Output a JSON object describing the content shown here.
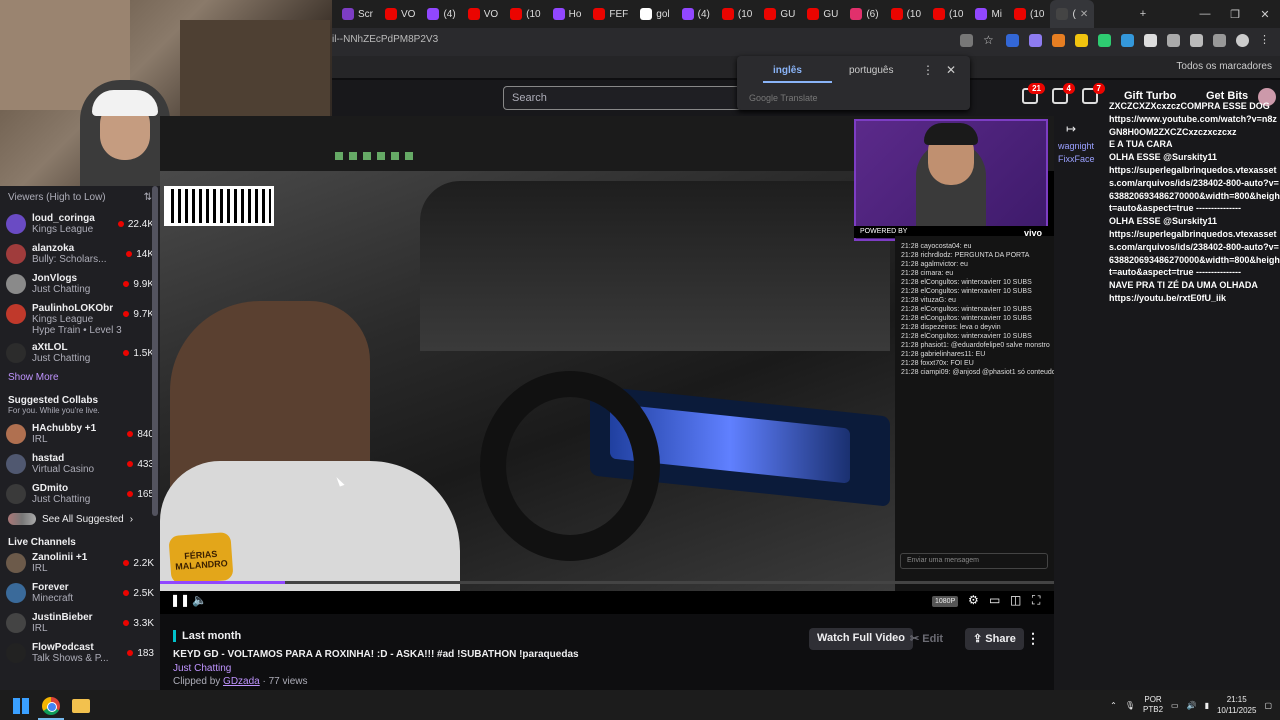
{
  "browser": {
    "tabs": [
      {
        "label": "Scr",
        "color": "#7d3dc4"
      },
      {
        "label": "VO",
        "color": "#eb0400"
      },
      {
        "label": "(4)",
        "color": "#9147ff"
      },
      {
        "label": "VO",
        "color": "#eb0400"
      },
      {
        "label": "(10",
        "color": "#eb0400"
      },
      {
        "label": "Ho",
        "color": "#9147ff"
      },
      {
        "label": "FEF",
        "color": "#eb0400"
      },
      {
        "label": "gol",
        "color": "#ffffff"
      },
      {
        "label": "(4)",
        "color": "#9147ff"
      },
      {
        "label": "(10",
        "color": "#eb0400"
      },
      {
        "label": "GU",
        "color": "#eb0400"
      },
      {
        "label": "GU",
        "color": "#eb0400"
      },
      {
        "label": "(6)",
        "color": "#e1306c"
      },
      {
        "label": "(10",
        "color": "#eb0400"
      },
      {
        "label": "(10",
        "color": "#eb0400"
      },
      {
        "label": "Mi",
        "color": "#9147ff"
      },
      {
        "label": "(10",
        "color": "#eb0400"
      },
      {
        "label": "(",
        "color": "#444444"
      }
    ],
    "url_fragment": "il--NNhZEcPdPM8P2V3",
    "bookmarks_label": "Todos os marcadores"
  },
  "translate": {
    "lang_from": "inglês",
    "lang_to": "português",
    "provider": "Google Translate"
  },
  "topnav": {
    "search_placeholder": "Search",
    "badge_inbox": "21",
    "badge_mail": "4",
    "badge_notif": "7",
    "gift_turbo": "Gift Turbo",
    "get_bits": "Get Bits"
  },
  "sidebar": {
    "sort_label": "Viewers (High to Low)",
    "followed": [
      {
        "name": "loud_coringa",
        "game": "Kings League",
        "viewers": "22.4K",
        "color": "#6a4bc4"
      },
      {
        "name": "alanzoka",
        "game": "Bully: Scholars...",
        "viewers": "14K",
        "color": "#a03c3c"
      },
      {
        "name": "JonVlogs",
        "game": "Just Chatting",
        "viewers": "9.9K",
        "color": "#8a8a8a"
      },
      {
        "name": "PaulinhoLOKObr",
        "game": "Kings League",
        "viewers": "9.7K",
        "color": "#c0392b"
      },
      {
        "name": "aXtLOL",
        "game": "Just Chatting",
        "viewers": "1.5K",
        "color": "#2c2c2c"
      }
    ],
    "hype_train": "Hype Train • Level 3",
    "show_more": "Show More",
    "suggested_title": "Suggested Collabs",
    "suggested_sub": "For you. While you're live.",
    "suggested": [
      {
        "name": "HAchubby +1",
        "game": "IRL",
        "viewers": "840",
        "color": "#b07050"
      },
      {
        "name": "hastad",
        "game": "Virtual Casino",
        "viewers": "433",
        "color": "#505870"
      },
      {
        "name": "GDmito",
        "game": "Just Chatting",
        "viewers": "165",
        "color": "#3a3a3a"
      }
    ],
    "see_all": "See All Suggested",
    "live_title": "Live Channels",
    "live": [
      {
        "name": "Zanolinii +1",
        "game": "IRL",
        "viewers": "2.2K",
        "color": "#6c5a4a"
      },
      {
        "name": "Forever",
        "game": "Minecraft",
        "viewers": "2.5K",
        "color": "#3a6a9a"
      },
      {
        "name": "JustinBieber",
        "game": "IRL",
        "viewers": "3.3K",
        "color": "#444444"
      },
      {
        "name": "FlowPodcast",
        "game": "Talk Shows & P...",
        "viewers": "183",
        "color": "#222222"
      }
    ]
  },
  "video": {
    "logo_text": "FÉRIAS MALANDRO",
    "chat_lines": [
      "21:28 cayocosta04: eu",
      "21:28 richrdlodz: PERGUNTA DA PORTA",
      "21:28 agalmvictor: eu",
      "21:28 cimara: eu",
      "21:28 elCongultos: winterxavierr 10 SUBS",
      "21:28 elCongultos: winterxavierr 10 SUBS",
      "21:28 vituzaG: eu",
      "21:28 elCongultos: winterxavierr 10 SUBS",
      "21:28 elCongultos: winterxavierr 10 SUBS",
      "21:28 dispezeiros: leva o deyvin",
      "21:28 elCongultos: winterxavierr 10 SUBS",
      "21:28 phasiot1: @eduardofelipe0 salve monstro",
      "21:28 gabrielinhares11: EU",
      "21:28 foxxt70x: FOI EU",
      "21:28 ciampi09: @anjosd @phasiot1 só conteudo"
    ],
    "chat_placeholder": "Enviar uma mensagem",
    "vivo_text": "POWERED BY",
    "vivo_brand": "vivo",
    "quality": "1080P",
    "progress": 0.14
  },
  "clip": {
    "period": "Last month",
    "title": "KEYD GD - VOLTAMOS PARA A ROXINHA! :D - ASKA!!! #ad !SUBATHON !paraquedas",
    "game": "Just Chatting",
    "clipped_by_prefix": "Clipped by",
    "clipper": "GDzada",
    "views": "· 77 views",
    "watch_full": "Watch Full Video",
    "edit": "Edit",
    "share": "Share"
  },
  "rchat": {
    "lines": [
      "ZXCZCXZXcxzczCOMPRA ESSE DOG",
      "https://www.youtube.com/watch?v=n8zGN8H0OM2ZXCZCxzczxczcxz",
      "E A TUA CARA",
      "OLHA ESSE @Surskity11",
      "https://superlegalbrinquedos.vtexassets.com/arquivos/ids/238402-800-auto?v=638820693486270000&width=800&height=auto&aspect=true ---------------",
      "OLHA ESSE @Surskity11",
      "https://superlegalbrinquedos.vtexassets.com/arquivos/ids/238402-800-auto?v=638820693486270000&width=800&height=auto&aspect=true ---------------",
      "NAVE PRA TI ZÉ DA UMA OLHADA",
      "https://youtu.be/rxtE0fU_iik"
    ],
    "names": [
      {
        "name": "wagnight",
        "color": "#9aa0ff"
      },
      {
        "name": "FixxFace",
        "color": "#9aa0ff"
      }
    ]
  },
  "taskbar": {
    "lang1": "POR",
    "lang2": "PTB2",
    "time": "21:15",
    "date": "10/11/2025"
  }
}
